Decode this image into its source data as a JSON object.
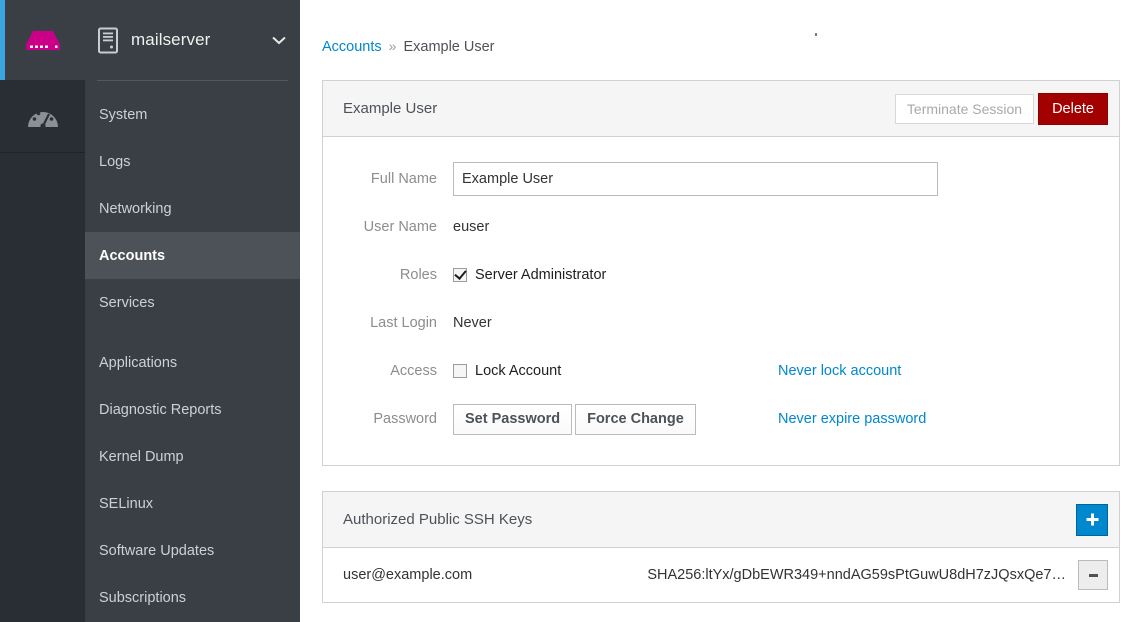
{
  "rail": {
    "brand_icon": "server-storage-icon",
    "brand_color": "#cc0088",
    "accent_color": "#39a5dc",
    "items": [
      {
        "icon": "dashboard-gauge-icon",
        "label": "Dashboard"
      }
    ]
  },
  "sidebar": {
    "host_icon": "server-tower-icon",
    "host_name": "mailserver",
    "host_dropdown_icon": "chevron-down-icon",
    "groups": [
      {
        "items": [
          {
            "label": "System",
            "active": false
          },
          {
            "label": "Logs",
            "active": false
          },
          {
            "label": "Networking",
            "active": false
          },
          {
            "label": "Accounts",
            "active": true
          },
          {
            "label": "Services",
            "active": false
          }
        ]
      },
      {
        "items": [
          {
            "label": "Applications",
            "active": false
          },
          {
            "label": "Diagnostic Reports",
            "active": false
          },
          {
            "label": "Kernel Dump",
            "active": false
          },
          {
            "label": "SELinux",
            "active": false
          },
          {
            "label": "Software Updates",
            "active": false
          },
          {
            "label": "Subscriptions",
            "active": false
          }
        ]
      }
    ]
  },
  "breadcrumb": {
    "root_label": "Accounts",
    "separator": "»",
    "current_label": "Example User"
  },
  "account_card": {
    "title": "Example User",
    "terminate_session_label": "Terminate Session",
    "terminate_session_disabled": true,
    "delete_label": "Delete",
    "delete_color": "#a30000",
    "fields": {
      "full_name": {
        "label": "Full Name",
        "value": "Example User",
        "placeholder": ""
      },
      "user_name": {
        "label": "User Name",
        "value": "euser"
      },
      "roles": {
        "label": "Roles",
        "checkbox_label": "Server Administrator",
        "checked": true
      },
      "last_login": {
        "label": "Last Login",
        "value": "Never"
      },
      "access": {
        "label": "Access",
        "checkbox_label": "Lock Account",
        "checked": false,
        "status_link": "Never lock account"
      },
      "password": {
        "label": "Password",
        "set_password_label": "Set Password",
        "force_change_label": "Force Change",
        "status_link": "Never expire password"
      }
    }
  },
  "ssh_card": {
    "title": "Authorized Public SSH Keys",
    "add_icon": "plus-icon",
    "add_color": "#0088ce",
    "remove_icon": "minus-icon",
    "keys": [
      {
        "name": "user@example.com",
        "fingerprint": "SHA256:ltYx/gDbEWR349+nndAG59sPtGuwU8dH7zJQsxQe7…",
        "remove_label": "-"
      }
    ]
  }
}
